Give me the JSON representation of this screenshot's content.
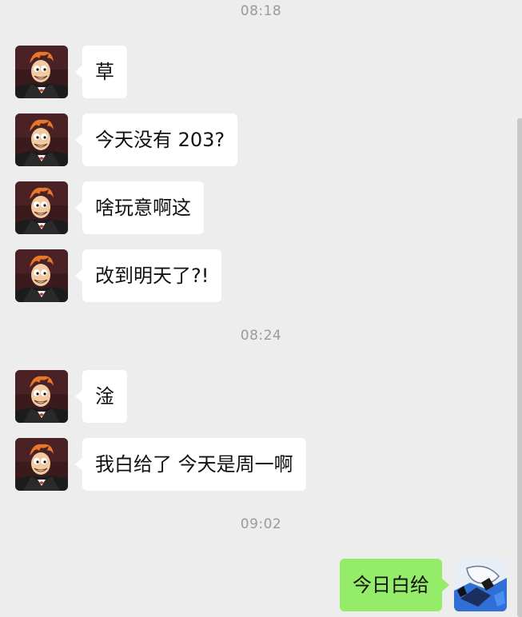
{
  "timestamps": [
    "08:18",
    "08:24",
    "09:02"
  ],
  "messages": [
    {
      "sender": "friend",
      "text": "草"
    },
    {
      "sender": "friend",
      "text": "今天没有 203?"
    },
    {
      "sender": "friend",
      "text": "啥玩意啊这"
    },
    {
      "sender": "friend",
      "text": "改到明天了?!"
    },
    {
      "sender": "friend",
      "text": "淦"
    },
    {
      "sender": "friend",
      "text": "我白给了 今天是周一啊"
    },
    {
      "sender": "me",
      "text": "今日白给"
    }
  ],
  "colors": {
    "background": "#ededed",
    "incoming_bubble": "#ffffff",
    "outgoing_bubble": "#95ec69",
    "timestamp_text": "#9a9a9a"
  },
  "icons": {
    "friend_avatar": "cartoon-character-avatar-icon",
    "self_avatar": "blue-white-mecha-avatar-icon"
  }
}
